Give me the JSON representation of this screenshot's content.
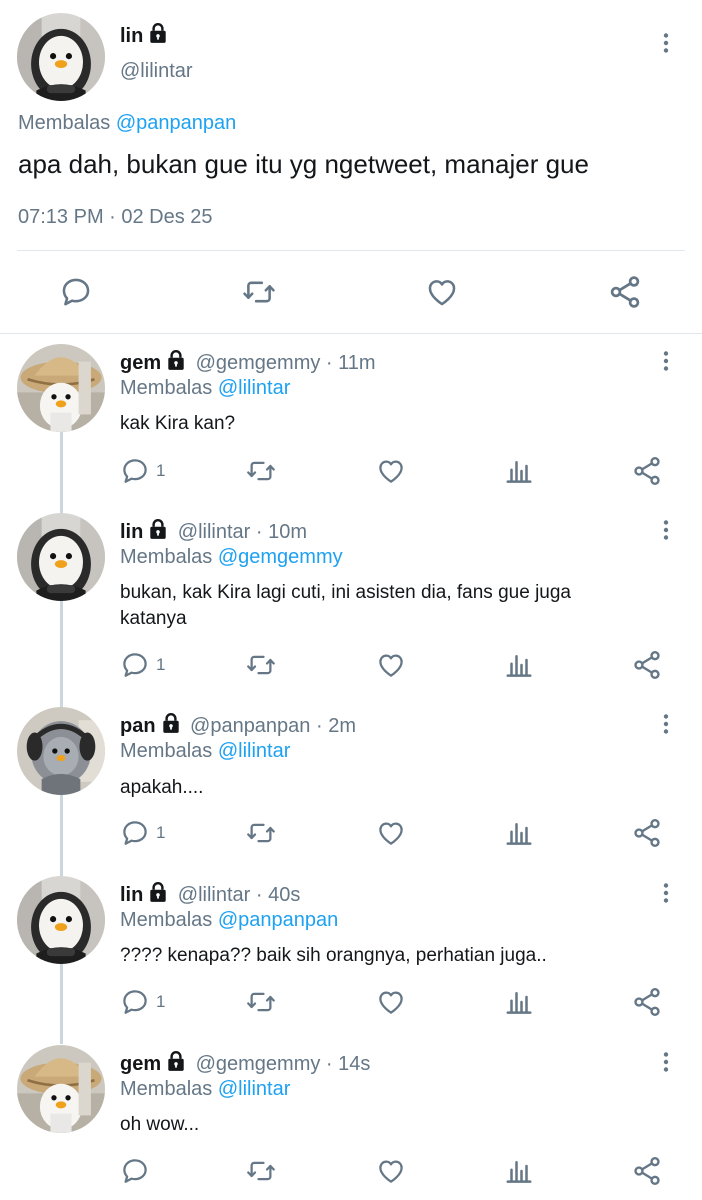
{
  "main_tweet": {
    "name": "lin",
    "handle": "@lilintar",
    "reply_prefix": "Membalas",
    "reply_to": "@panpanpan",
    "text": "apa dah, bukan gue itu yg ngetweet, manajer gue",
    "timestamp": "07:13 PM · 02 Des 25",
    "icons": [
      "reply-icon",
      "retweet-icon",
      "like-icon",
      "share-icon"
    ]
  },
  "replies": [
    {
      "name": "gem",
      "meta": "@gemgemmy · 11m",
      "reply_prefix": "Membalas",
      "reply_to": "@lilintar",
      "text": "kak Kira kan?",
      "reply_count": "1",
      "avatar": "gem"
    },
    {
      "name": "lin",
      "meta": "@lilintar · 10m",
      "reply_prefix": "Membalas",
      "reply_to": "@gemgemmy",
      "text": "bukan, kak Kira lagi cuti, ini asisten dia, fans gue juga katanya",
      "reply_count": "1",
      "avatar": "lin"
    },
    {
      "name": "pan",
      "meta": "@panpanpan · 2m",
      "reply_prefix": "Membalas",
      "reply_to": "@lilintar",
      "text": "apakah....",
      "reply_count": "1",
      "avatar": "pan"
    },
    {
      "name": "lin",
      "meta": "@lilintar · 40s",
      "reply_prefix": "Membalas",
      "reply_to": "@panpanpan",
      "text": "???? kenapa?? baik sih orangnya, perhatian juga..",
      "reply_count": "1",
      "avatar": "lin"
    },
    {
      "name": "gem",
      "meta": "@gemgemmy · 14s",
      "reply_prefix": "Membalas",
      "reply_to": "@lilintar",
      "text": "oh wow...",
      "reply_count": "",
      "avatar": "gem"
    }
  ],
  "colors": {
    "accent": "#1da1f2",
    "secondary_text": "#657786",
    "divider": "#e1e8ed"
  }
}
